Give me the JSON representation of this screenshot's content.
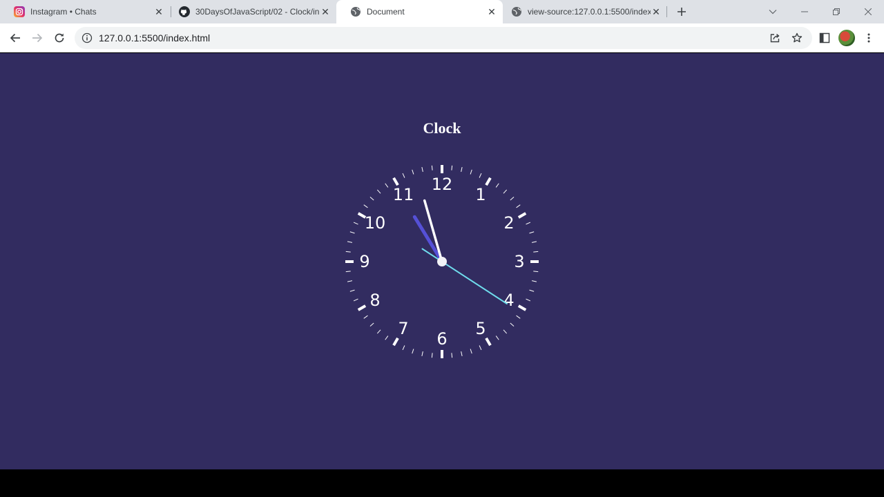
{
  "tabs": [
    {
      "title": "Instagram • Chats",
      "favicon": "instagram-icon",
      "active": false
    },
    {
      "title": "30DaysOfJavaScript/02 - Clock/in",
      "favicon": "github-icon",
      "active": false
    },
    {
      "title": "Document",
      "favicon": "globe-icon",
      "active": true
    },
    {
      "title": "view-source:127.0.0.1:5500/index",
      "favicon": "globe-icon",
      "active": false
    }
  ],
  "toolbar": {
    "url": "127.0.0.1:5500/index.html"
  },
  "page": {
    "heading": "Clock"
  },
  "clock": {
    "numerals": [
      "12",
      "1",
      "2",
      "3",
      "4",
      "5",
      "6",
      "7",
      "8",
      "9",
      "10",
      "11"
    ],
    "time": {
      "hours": 10,
      "minutes": 57,
      "seconds": 20.5
    },
    "colors": {
      "background": "#322c60",
      "face": "#ffffff",
      "hour_hand": "#5550d6",
      "minute_hand": "#ffffff",
      "second_hand": "#6fdcec"
    }
  }
}
